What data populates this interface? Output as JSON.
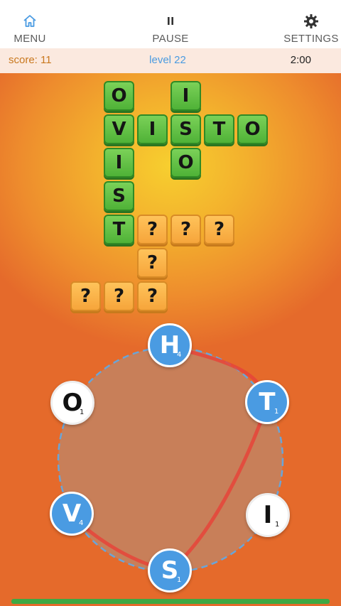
{
  "nav": {
    "menu_label": "MENU",
    "pause_label": "PAUSE",
    "settings_label": "SETTINGS"
  },
  "status": {
    "score": "score: 11",
    "level": "level 22",
    "timer": "2:00"
  },
  "colors": {
    "solved_tile": "#5bbd3f",
    "hidden_tile": "#f8b04a",
    "active_letter": "#4a9be2",
    "selection_line": "#e6443a"
  },
  "grid": {
    "tiles": [
      {
        "row": 0,
        "col": 0,
        "text": "O",
        "state": "solved"
      },
      {
        "row": 0,
        "col": 2,
        "text": "I",
        "state": "solved"
      },
      {
        "row": 1,
        "col": 0,
        "text": "V",
        "state": "solved"
      },
      {
        "row": 1,
        "col": 1,
        "text": "I",
        "state": "solved"
      },
      {
        "row": 1,
        "col": 2,
        "text": "S",
        "state": "solved"
      },
      {
        "row": 1,
        "col": 3,
        "text": "T",
        "state": "solved"
      },
      {
        "row": 1,
        "col": 4,
        "text": "O",
        "state": "solved"
      },
      {
        "row": 2,
        "col": 0,
        "text": "I",
        "state": "solved"
      },
      {
        "row": 2,
        "col": 2,
        "text": "O",
        "state": "solved"
      },
      {
        "row": 3,
        "col": 0,
        "text": "S",
        "state": "solved"
      },
      {
        "row": 4,
        "col": 0,
        "text": "T",
        "state": "solved"
      },
      {
        "row": 4,
        "col": 1,
        "text": "?",
        "state": "hidden"
      },
      {
        "row": 4,
        "col": 2,
        "text": "?",
        "state": "hidden"
      },
      {
        "row": 4,
        "col": 3,
        "text": "?",
        "state": "hidden"
      },
      {
        "row": 5,
        "col": 1,
        "text": "?",
        "state": "hidden"
      },
      {
        "row": 6,
        "col": -1,
        "text": "?",
        "state": "hidden"
      },
      {
        "row": 6,
        "col": 0,
        "text": "?",
        "state": "hidden"
      },
      {
        "row": 6,
        "col": 1,
        "text": "?",
        "state": "hidden"
      }
    ]
  },
  "wheel": {
    "letters": [
      {
        "id": "h",
        "letter": "H",
        "points": "4",
        "state": "active"
      },
      {
        "id": "t",
        "letter": "T",
        "points": "1",
        "state": "active"
      },
      {
        "id": "i",
        "letter": "I",
        "points": "1",
        "state": "idle"
      },
      {
        "id": "s",
        "letter": "S",
        "points": "1",
        "state": "active"
      },
      {
        "id": "v",
        "letter": "V",
        "points": "4",
        "state": "active"
      },
      {
        "id": "o",
        "letter": "O",
        "points": "1",
        "state": "idle"
      }
    ]
  }
}
